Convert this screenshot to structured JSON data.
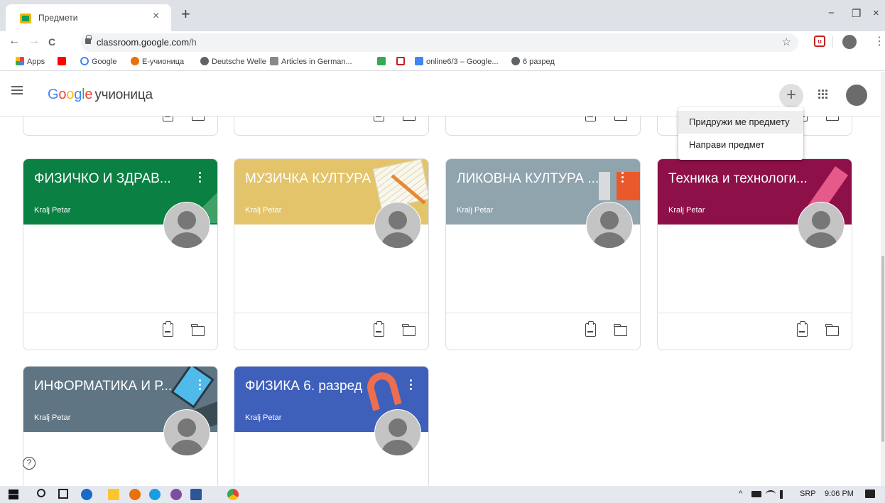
{
  "browser": {
    "tab_title": "Предмети",
    "tab_close": "×",
    "new_tab": "+",
    "window_controls": [
      "−",
      "❐",
      "×"
    ],
    "url_host": "classroom.google.com",
    "url_path": "/h",
    "star": "☆",
    "ext_label": "ʊ",
    "menu_dots": "⋮",
    "nav": [
      "←",
      "→",
      "C"
    ],
    "bookmarks": [
      {
        "label": "Apps",
        "color": "#ea4335"
      },
      {
        "label": "",
        "color": "#ff0000"
      },
      {
        "label": "Google",
        "color": "#4285f4"
      },
      {
        "label": "Е-учионица",
        "color": "#e8710a"
      },
      {
        "label": "Deutsche Welle",
        "color": "#5f6368"
      },
      {
        "label": "Articles in German...",
        "color": "#888888"
      },
      {
        "label": "",
        "color": "#34a853"
      },
      {
        "label": "",
        "color": "#c5221f"
      },
      {
        "label": "online6/3 – Google...",
        "color": "#4285f4"
      },
      {
        "label": "6 разред",
        "color": "#5f6368"
      }
    ]
  },
  "header": {
    "logo_G": "G",
    "logo_o1": "o",
    "logo_o2": "o",
    "logo_g": "g",
    "logo_l": "l",
    "logo_e": "e",
    "product": "учионица",
    "plus": "+"
  },
  "dropdown": {
    "items": [
      "Придружи ме предмету",
      "Направи предмет"
    ]
  },
  "cards": [
    {
      "title": "ФИЗИЧКО И ЗДРАВ...",
      "owner": "Kralj Petar",
      "color": "#0b8043"
    },
    {
      "title": "МУЗИЧКА КУЛТУРА ...",
      "owner": "Kralj Petar",
      "color": "#e3c46b"
    },
    {
      "title": "ЛИКОВНА КУЛТУРА ...",
      "owner": "Kralj Petar",
      "color": "#90a4ae"
    },
    {
      "title": "Техника и технологи...",
      "owner": "Kralj Petar",
      "color": "#8e1049"
    },
    {
      "title": "ИНФОРМАТИКА И Р...",
      "owner": "Kralj Petar",
      "color": "#5f7583"
    },
    {
      "title": "ФИЗИКА 6. разред",
      "owner": "Kralj Petar",
      "color": "#3e5fba"
    }
  ],
  "help": "?",
  "taskbar": {
    "lang": "SRP",
    "time": "9:06 PM",
    "tray_up": "^"
  }
}
